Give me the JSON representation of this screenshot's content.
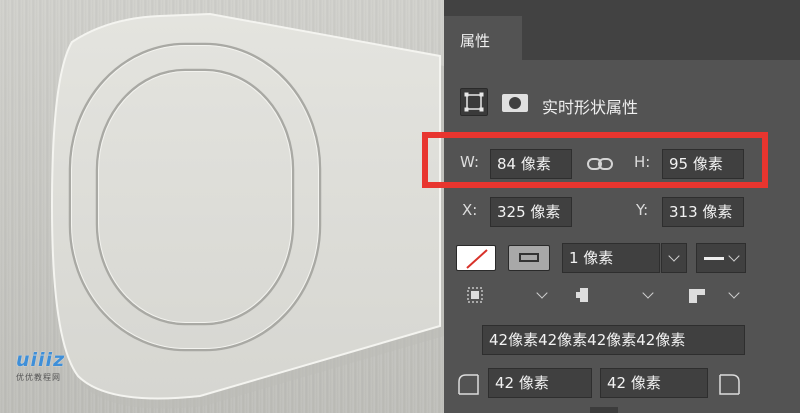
{
  "watermark": {
    "logo": "uiiiz",
    "sub": "优优教程网"
  },
  "panel": {
    "tab_label": "属性",
    "shape_title": "实时形状属性",
    "width": {
      "label": "W:",
      "value": "84 像素"
    },
    "height": {
      "label": "H:",
      "value": "95 像素"
    },
    "pos_x": {
      "label": "X:",
      "value": "325 像素"
    },
    "pos_y": {
      "label": "Y:",
      "value": "313 像素"
    },
    "stroke_width": "1 像素",
    "corner_radii": "42像素42像素42像素42像素",
    "corner_tl": "42 像素",
    "corner_tr": "42 像素"
  },
  "colors": {
    "highlight": "#e8352f",
    "panel_bg": "#535353",
    "field_bg": "#404040",
    "fill_none_slash": "#d8322a"
  }
}
